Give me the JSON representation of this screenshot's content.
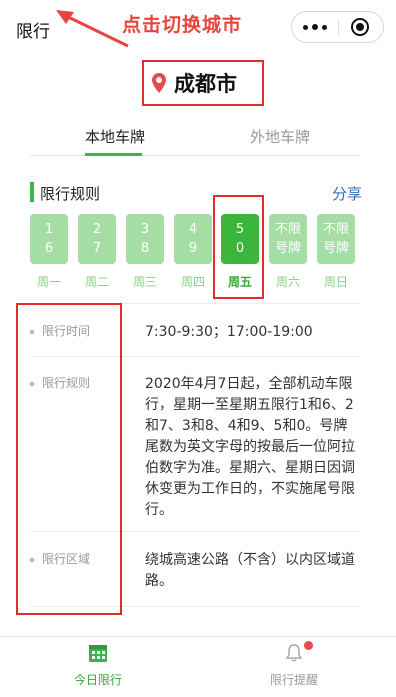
{
  "topbar": {
    "title": "限行"
  },
  "annotation": {
    "text": "点击切换城市"
  },
  "city": {
    "name": "成都市"
  },
  "tabs": [
    {
      "label": "本地车牌"
    },
    {
      "label": "外地车牌"
    }
  ],
  "rules": {
    "title": "限行规则",
    "share_label": "分享"
  },
  "days": [
    {
      "line1": "1",
      "line2": "6",
      "name": "周一"
    },
    {
      "line1": "2",
      "line2": "7",
      "name": "周二"
    },
    {
      "line1": "3",
      "line2": "8",
      "name": "周三"
    },
    {
      "line1": "4",
      "line2": "9",
      "name": "周四"
    },
    {
      "line1": "5",
      "line2": "0",
      "name": "周五"
    },
    {
      "line1": "不限",
      "line2": "号牌",
      "name": "周六"
    },
    {
      "line1": "不限",
      "line2": "号牌",
      "name": "周日"
    }
  ],
  "info": {
    "time": {
      "key": "限行时间",
      "value": "7:30-9:30；17:00-19:00"
    },
    "rule": {
      "key": "限行规则",
      "value": "2020年4月7日起，全部机动车限行，星期一至星期五限行1和6、2和7、3和8、4和9、5和0。号牌尾数为英文字母的按最后一位阿拉伯数字为准。星期六、星期日因调休变更为工作日的，不实施尾号限行。"
    },
    "area": {
      "key": "限行区域",
      "value": "绕城高速公路（不含）以内区域道路。"
    }
  },
  "bottom_nav": [
    {
      "label": "今日限行"
    },
    {
      "label": "限行提醒"
    }
  ],
  "colors": {
    "green": "#3bb54a",
    "light_green": "#a5dea5",
    "highlight_red": "#e22d2d",
    "link_blue": "#2f6fbf"
  }
}
